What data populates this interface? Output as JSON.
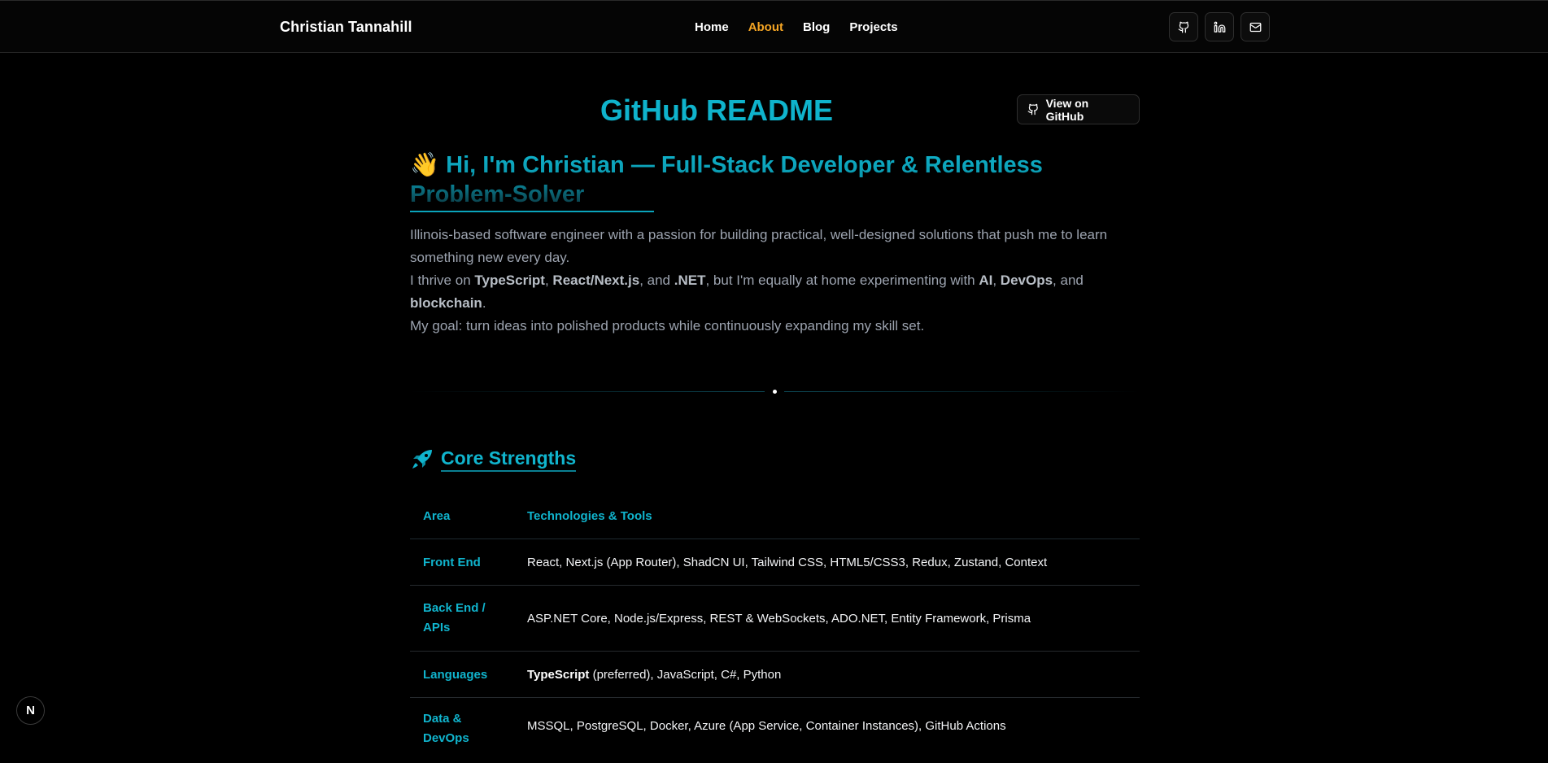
{
  "header": {
    "brand": "Christian Tannahill",
    "nav": [
      {
        "label": "Home",
        "active": false
      },
      {
        "label": "About",
        "active": true
      },
      {
        "label": "Blog",
        "active": false
      },
      {
        "label": "Projects",
        "active": false
      }
    ],
    "social_icons": [
      "github-icon",
      "linkedin-icon",
      "mail-icon"
    ]
  },
  "page": {
    "title": "GitHub README",
    "view_button": "View on GitHub",
    "hero_emoji": "👋",
    "hero": "Hi, I'm Christian — Full-Stack Developer & Relentless Problem-Solver",
    "intro": {
      "line1": "Illinois-based software engineer with a passion for building practical, well-designed solutions that push me to learn something new every day.",
      "l2_a": "I thrive on ",
      "l2_ts": "TypeScript",
      "l2_sep1": ", ",
      "l2_react": "React/Next.js",
      "l2_sep2": ", and ",
      "l2_net": ".NET",
      "l2_mid": ", but I'm equally at home experimenting with ",
      "l2_ai": "AI",
      "l2_sep3": ", ",
      "l2_devops": "DevOps",
      "l2_sep4": ", and ",
      "l2_blockchain": "blockchain",
      "l2_end": ".",
      "line3": "My goal: turn ideas into polished products while continuously expanding my skill set."
    }
  },
  "core_strengths": {
    "emoji": "🚀",
    "title": "Core Strengths",
    "columns": [
      "Area",
      "Technologies & Tools"
    ],
    "rows": [
      {
        "area": "Front End",
        "tools": "React, Next.js (App Router), ShadCN UI, Tailwind CSS, HTML5/CSS3, Redux, Zustand, Context"
      },
      {
        "area": "Back End / APIs",
        "tools": "ASP.NET Core, Node.js/Express, REST & WebSockets, ADO.NET, Entity Framework, Prisma"
      },
      {
        "area": "Languages",
        "tools_bold": "TypeScript",
        "tools": " (preferred), JavaScript, C#, Python"
      },
      {
        "area": "Data & DevOps",
        "tools": "MSSQL, PostgreSQL, Docker, Azure (App Service, Container Instances), GitHub Actions"
      }
    ]
  },
  "dev_badge": "N",
  "colors": {
    "accent": "#10b4cd",
    "active_nav": "#f5a524",
    "background": "#000000"
  }
}
